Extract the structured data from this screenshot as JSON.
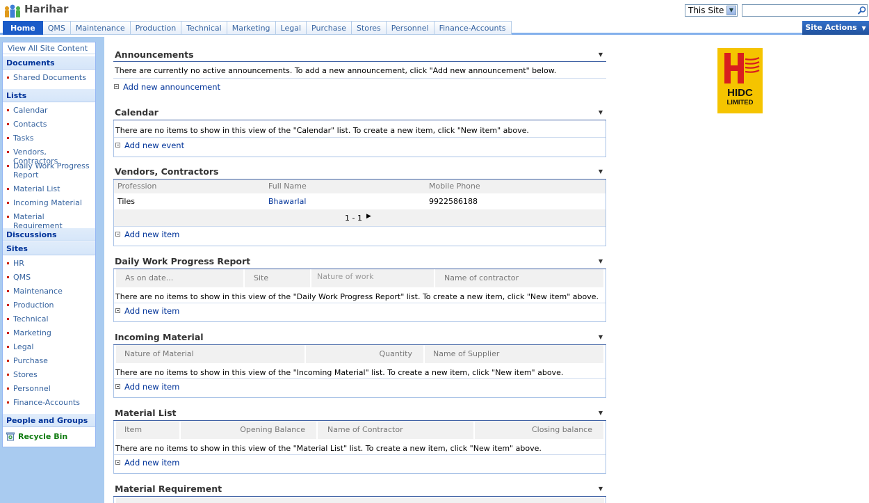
{
  "header": {
    "site_title": "Harihar",
    "scope": "This Site",
    "search_placeholder": ""
  },
  "topnav": {
    "tabs": [
      "Home",
      "QMS",
      "Maintenance",
      "Production",
      "Technical",
      "Marketing",
      "Legal",
      "Purchase",
      "Stores",
      "Personnel",
      "Finance-Accounts"
    ],
    "site_actions": "Site Actions"
  },
  "quicklaunch": {
    "view_all": "View All Site Content",
    "documents": {
      "title": "Documents",
      "items": [
        "Shared Documents"
      ]
    },
    "lists": {
      "title": "Lists",
      "items": [
        "Calendar",
        "Contacts",
        "Tasks",
        "Vendors, Contractors",
        "Daily Work Progress Report",
        "Material List",
        "Incoming Material",
        "Material Requirement"
      ]
    },
    "discussions": {
      "title": "Discussions"
    },
    "sites": {
      "title": "Sites",
      "items": [
        "HR",
        "QMS",
        "Maintenance",
        "Production",
        "Technical",
        "Marketing",
        "Legal",
        "Purchase",
        "Stores",
        "Personnel",
        "Finance-Accounts"
      ]
    },
    "people": {
      "title": "People and Groups"
    },
    "recycle": "Recycle Bin"
  },
  "webparts": {
    "announcements": {
      "title": "Announcements",
      "message": "There are currently no active announcements. To add a new announcement, click \"Add new announcement\" below.",
      "add": "Add new announcement"
    },
    "calendar": {
      "title": "Calendar",
      "message": "There are no items to show in this view of the \"Calendar\" list. To create a new item, click \"New item\" above.",
      "add": "Add new event"
    },
    "vendors": {
      "title": "Vendors, Contractors",
      "columns": [
        "Profession",
        "Full Name",
        "Mobile Phone"
      ],
      "rows": [
        {
          "profession": "Tiles",
          "full_name": "Bhawarlal",
          "mobile": "9922586188"
        }
      ],
      "paging": "1 - 1",
      "add": "Add new item"
    },
    "dwpr": {
      "title": "Daily Work Progress Report",
      "columns": [
        "As on date...",
        "Site",
        "Nature of work",
        "Name of contractor"
      ],
      "message": "There are no items to show in this view of the \"Daily Work Progress Report\" list. To create a new item, click \"New item\" above.",
      "add": "Add new item"
    },
    "incoming": {
      "title": "Incoming Material",
      "columns": [
        "Nature of Material",
        "Quantity",
        "Name of Supplier"
      ],
      "message": "There are no items to show in this view of the \"Incoming Material\" list. To create a new item, click \"New item\" above.",
      "add": "Add new item"
    },
    "material_list": {
      "title": "Material List",
      "columns": [
        "Item",
        "Opening Balance",
        "Name of Contractor",
        "Closing balance"
      ],
      "message": "There are no items to show in this view of the \"Material List\" list. To create a new item, click \"New item\" above.",
      "add": "Add new item"
    },
    "material_requirement": {
      "title": "Material Requirement"
    }
  },
  "logo": {
    "text_line1": "HIDC",
    "text_line2": "LIMITED",
    "color": "#f5c400",
    "mark_color": "#d81e1e"
  }
}
